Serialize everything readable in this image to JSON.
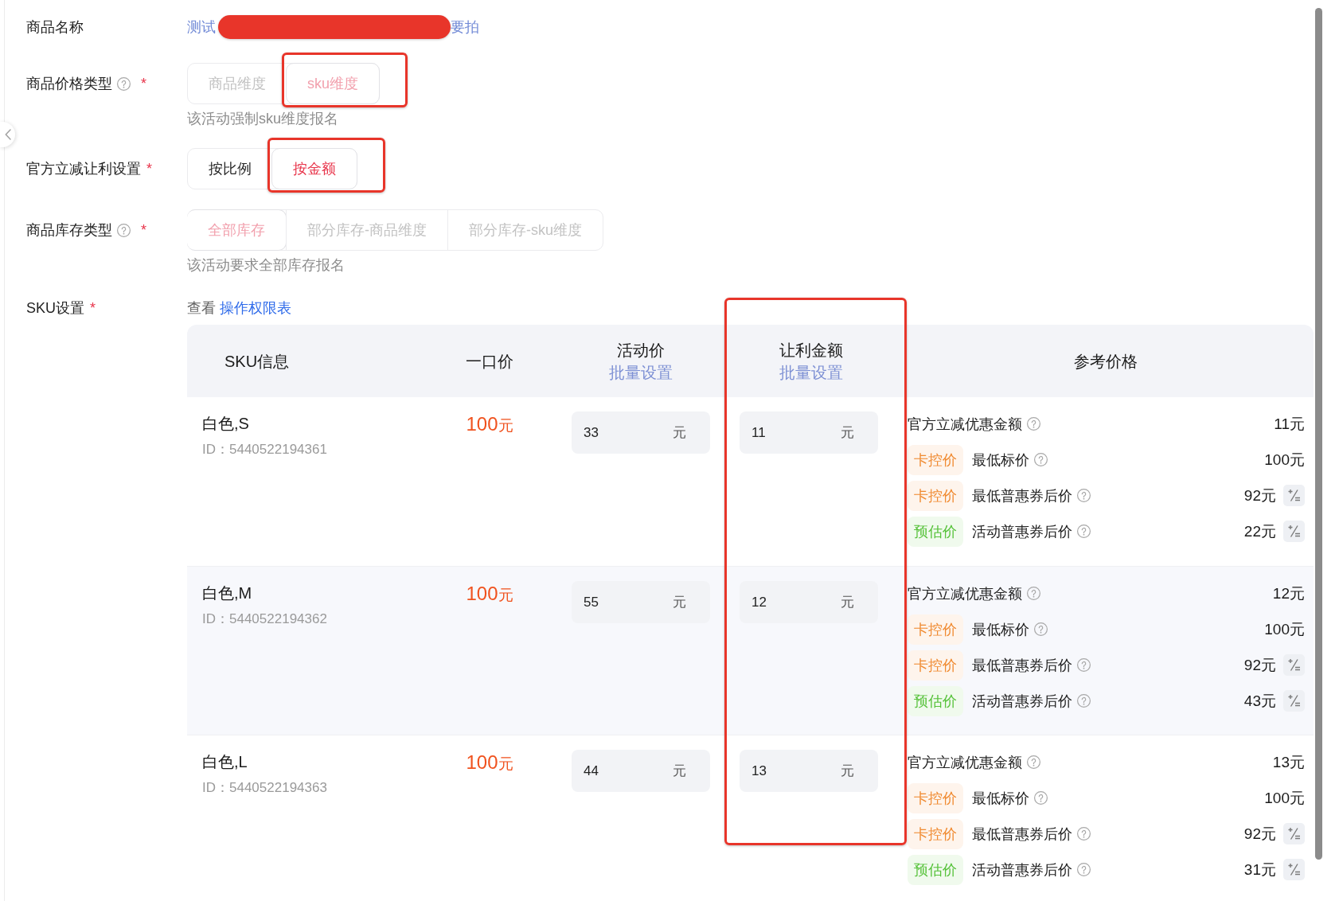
{
  "form": {
    "items": [
      {
        "kind": "product_name",
        "label": "商品名称",
        "help": false,
        "name_parts": [
          "测试",
          "要拍"
        ],
        "redacted": true
      },
      {
        "kind": "segmented",
        "label": "商品价格类型",
        "help": true,
        "required_mark": "*",
        "disabled": true,
        "options": [
          {
            "label": "商品维度",
            "selected": false,
            "annotated": false
          },
          {
            "label": "sku维度",
            "selected": true,
            "annotated": true
          }
        ],
        "hint": "该活动强制sku维度报名"
      },
      {
        "kind": "segmented",
        "label": "官方立减让利设置",
        "help": false,
        "required_mark": "*",
        "disabled": false,
        "options": [
          {
            "label": "按比例",
            "selected": false,
            "annotated": false
          },
          {
            "label": "按金额",
            "selected": true,
            "annotated": true
          }
        ]
      },
      {
        "kind": "segmented",
        "label": "商品库存类型",
        "help": true,
        "required_mark": "*",
        "disabled": true,
        "options": [
          {
            "label": "全部库存",
            "selected": true,
            "annotated": false
          },
          {
            "label": "部分库存-商品维度",
            "selected": false,
            "annotated": false
          },
          {
            "label": "部分库存-sku维度",
            "selected": false,
            "annotated": false
          }
        ],
        "hint": "该活动要求全部库存报名"
      },
      {
        "kind": "link_line",
        "label": "SKU设置",
        "help": false,
        "required_mark": "*",
        "prefix": "查看",
        "link": "操作权限表"
      }
    ]
  },
  "table": {
    "columns": [
      {
        "title": "SKU信息",
        "annotated": false
      },
      {
        "title": "一口价",
        "annotated": false
      },
      {
        "title": "活动价",
        "action": "批量设置",
        "annotated": false
      },
      {
        "title": "让利金额",
        "action": "批量设置",
        "annotated": true
      },
      {
        "title": "参考价格",
        "annotated": false
      }
    ],
    "rows": [
      {
        "name": "白色,S",
        "id": "ID：5440522194361",
        "price": "100",
        "price_unit": "元",
        "hovered": false,
        "activity_price": {
          "value": "33",
          "unit": "元"
        },
        "discount": {
          "value": "11",
          "unit": "元"
        },
        "reference": [
          {
            "kind": "official",
            "label": "官方立减优惠金额",
            "help": true,
            "value": "11元",
            "adjustable": false
          },
          {
            "kind": "tagged",
            "tag": "卡控价",
            "color": "#f08a30",
            "label": "最低标价",
            "help": true,
            "value": "100元",
            "adjustable": false
          },
          {
            "kind": "tagged",
            "tag": "卡控价",
            "color": "#f08a30",
            "label": "最低普惠券后价",
            "help": true,
            "value": "92元",
            "adjustable": true
          },
          {
            "kind": "tagged",
            "tag": "预估价",
            "color": "#56c23a",
            "label": "活动普惠券后价",
            "help": true,
            "value": "22元",
            "adjustable": true
          }
        ]
      },
      {
        "name": "白色,M",
        "id": "ID：5440522194362",
        "price": "100",
        "price_unit": "元",
        "hovered": true,
        "activity_price": {
          "value": "55",
          "unit": "元"
        },
        "discount": {
          "value": "12",
          "unit": "元"
        },
        "reference": [
          {
            "kind": "official",
            "label": "官方立减优惠金额",
            "help": true,
            "value": "12元",
            "adjustable": false
          },
          {
            "kind": "tagged",
            "tag": "卡控价",
            "color": "#f08a30",
            "label": "最低标价",
            "help": true,
            "value": "100元",
            "adjustable": false
          },
          {
            "kind": "tagged",
            "tag": "卡控价",
            "color": "#f08a30",
            "label": "最低普惠券后价",
            "help": true,
            "value": "92元",
            "adjustable": true
          },
          {
            "kind": "tagged",
            "tag": "预估价",
            "color": "#56c23a",
            "label": "活动普惠券后价",
            "help": true,
            "value": "43元",
            "adjustable": true
          }
        ]
      },
      {
        "name": "白色,L",
        "id": "ID：5440522194363",
        "price": "100",
        "price_unit": "元",
        "hovered": false,
        "activity_price": {
          "value": "44",
          "unit": "元"
        },
        "discount": {
          "value": "13",
          "unit": "元"
        },
        "reference": [
          {
            "kind": "official",
            "label": "官方立减优惠金额",
            "help": true,
            "value": "13元",
            "adjustable": false
          },
          {
            "kind": "tagged",
            "tag": "卡控价",
            "color": "#f08a30",
            "label": "最低标价",
            "help": true,
            "value": "100元",
            "adjustable": false
          },
          {
            "kind": "tagged",
            "tag": "卡控价",
            "color": "#f08a30",
            "label": "最低普惠券后价",
            "help": true,
            "value": "92元",
            "adjustable": true
          },
          {
            "kind": "tagged",
            "tag": "预估价",
            "color": "#56c23a",
            "label": "活动普惠券后价",
            "help": true,
            "value": "31元",
            "adjustable": true
          }
        ]
      }
    ]
  }
}
